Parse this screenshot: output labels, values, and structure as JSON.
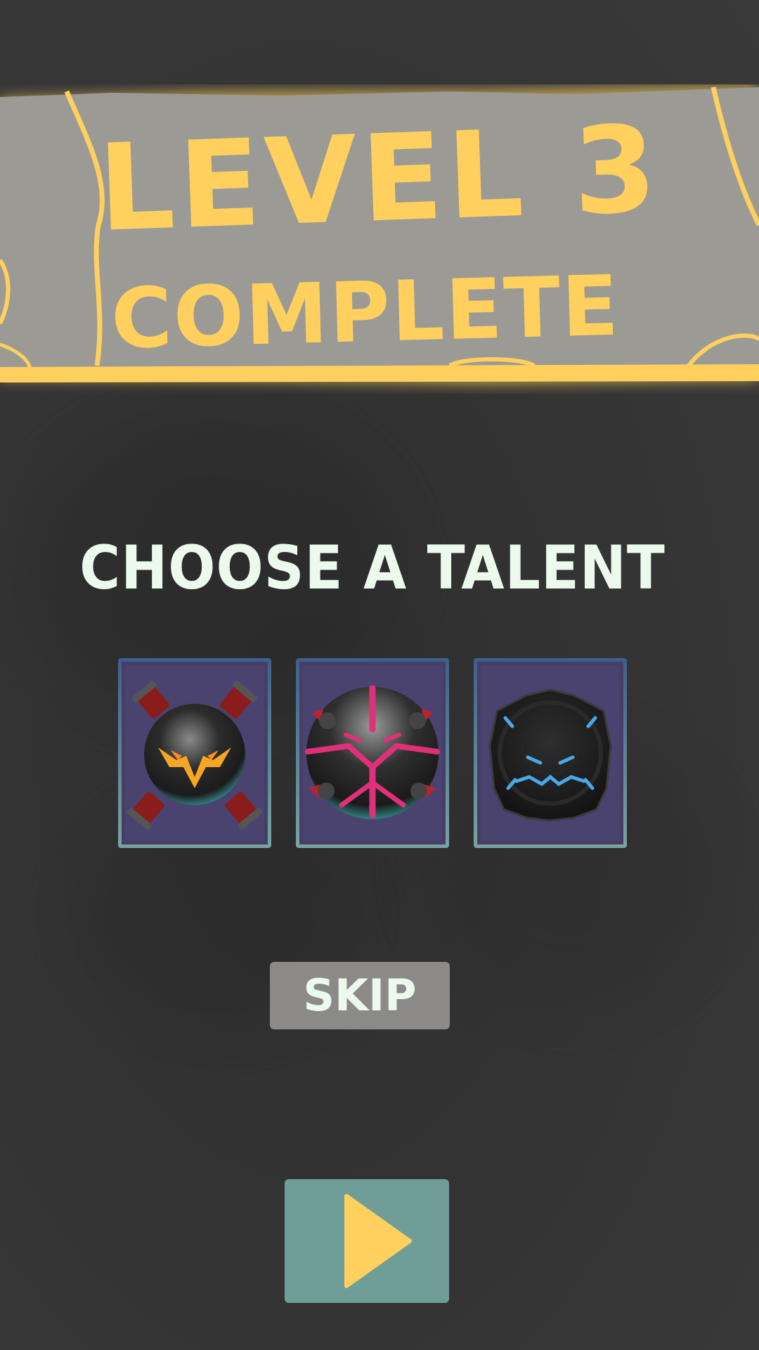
{
  "banner": {
    "line1": "LEVEL 3",
    "line2": "COMPLETE"
  },
  "talents": {
    "heading": "CHOOSE A TALENT",
    "options": [
      {
        "icon": "fire-orb-icon",
        "accent": "#f5a623"
      },
      {
        "icon": "magenta-spiked-orb-icon",
        "accent": "#e0307a"
      },
      {
        "icon": "blue-shield-orb-icon",
        "accent": "#4aa8e8"
      }
    ]
  },
  "actions": {
    "skip_label": "SKIP",
    "play_icon": "play-icon"
  },
  "colors": {
    "background": "#333333",
    "banner_fill": "#9b9a95",
    "banner_text": "#ffd05e",
    "heading_text": "#ecfaed",
    "card_fill": "#453e66",
    "skip_button": "#8c8989",
    "play_button": "#6f9d98",
    "play_triangle": "#ffd05e"
  }
}
